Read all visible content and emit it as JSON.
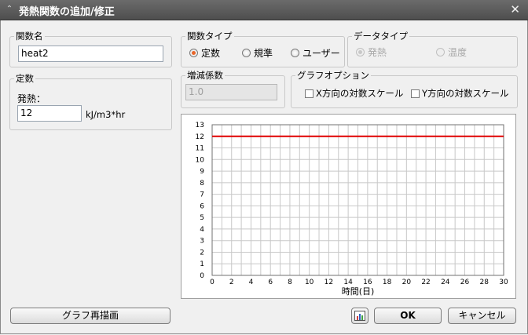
{
  "window": {
    "title": "発熱関数の追加/修正",
    "close_glyph": "✕"
  },
  "function_name": {
    "legend": "関数名",
    "value": "heat2"
  },
  "constant": {
    "legend": "定数",
    "label": "発熱：",
    "value": "12",
    "unit": "kJ/m3*hr"
  },
  "function_type": {
    "legend": "関数タイプ",
    "options": [
      "定数",
      "規準",
      "ユーザー"
    ],
    "selected": "定数"
  },
  "data_type": {
    "legend": "データタイプ",
    "options": [
      "発熱",
      "温度"
    ],
    "selected": "発熱"
  },
  "increment": {
    "legend": "増減係数",
    "value": "1.0"
  },
  "graph_options": {
    "legend": "グラフオプション",
    "x_log": "X方向の対数スケール",
    "y_log": "Y方向の対数スケール"
  },
  "buttons": {
    "redraw": "グラフ再描画",
    "ok": "OK",
    "cancel": "キャンセル"
  },
  "chart_data": {
    "type": "line",
    "xlabel": "時間(日)",
    "ylabel": "",
    "xlim": [
      0,
      30
    ],
    "ylim": [
      0,
      13
    ],
    "x_ticks": [
      0,
      2,
      4,
      6,
      8,
      10,
      12,
      14,
      16,
      18,
      20,
      22,
      24,
      26,
      28,
      30
    ],
    "y_ticks": [
      0,
      1,
      2,
      3,
      4,
      5,
      6,
      7,
      8,
      9,
      10,
      11,
      12,
      13
    ],
    "grid": true,
    "series": [
      {
        "x": [
          0,
          30
        ],
        "y": [
          12,
          12
        ],
        "color": "#e00000"
      }
    ]
  }
}
